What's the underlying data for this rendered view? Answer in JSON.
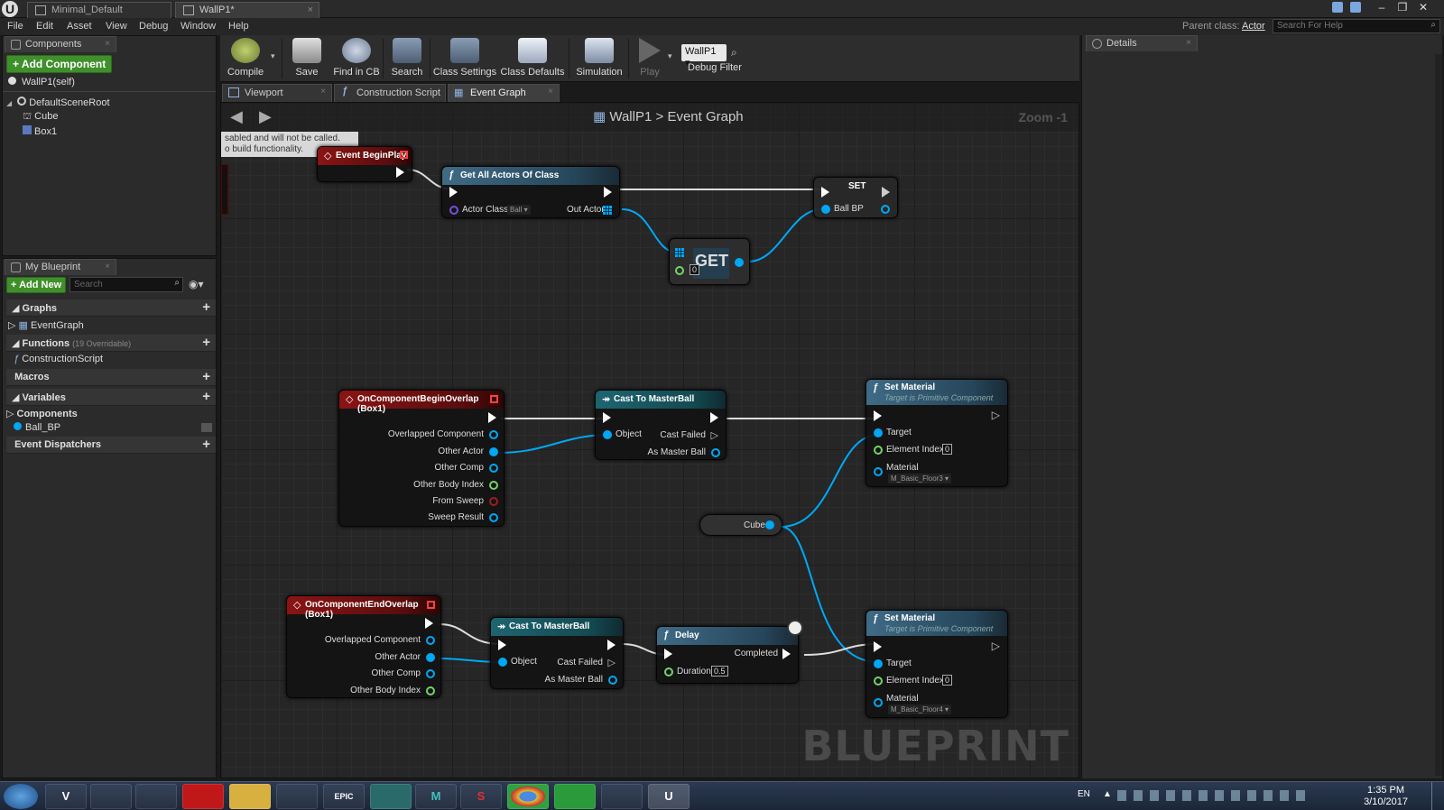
{
  "window": {
    "tabs": [
      {
        "label": "Minimal_Default"
      },
      {
        "label": "WallP1*"
      }
    ]
  },
  "menu": [
    "File",
    "Edit",
    "Asset",
    "View",
    "Debug",
    "Window",
    "Help"
  ],
  "parent_class": {
    "label": "Parent class:",
    "value": "Actor"
  },
  "help_search": {
    "placeholder": "Search For Help"
  },
  "components_panel": {
    "tab": "Components",
    "add_button": "+ Add Component",
    "self_item": "WallP1(self)",
    "root": "DefaultSceneRoot",
    "children": [
      "Cube",
      "Box1"
    ]
  },
  "my_blueprint": {
    "tab": "My Blueprint",
    "add_new": "+ Add New",
    "search_placeholder": "Search",
    "graphs_header": "Graphs",
    "graphs": [
      "EventGraph"
    ],
    "functions_header": "Functions",
    "functions_count": "(19 Overridable)",
    "functions": [
      "ConstructionScript"
    ],
    "macros_header": "Macros",
    "variables_header": "Variables",
    "var_category": "Components",
    "variables": [
      "Ball_BP"
    ],
    "dispatchers_header": "Event Dispatchers"
  },
  "toolbar": {
    "compile": "Compile",
    "save": "Save",
    "find_in_cb": "Find in CB",
    "search": "Search",
    "class_settings": "Class Settings",
    "class_defaults": "Class Defaults",
    "simulation": "Simulation",
    "play": "Play",
    "debug_object": "WallP1",
    "debug_filter": "Debug Filter"
  },
  "graph_tabs": [
    "Viewport",
    "Construction Script",
    "Event Graph"
  ],
  "graph": {
    "breadcrumb_root": "WallP1",
    "breadcrumb_sep": ">",
    "breadcrumb_current": "Event Graph",
    "zoom": "Zoom -1",
    "warning_line1": "sabled and will not be called.",
    "warning_line2": "o build functionality.",
    "watermark": "BLUEPRINT"
  },
  "nodes": {
    "begin_play": {
      "title": "Event BeginPlay"
    },
    "get_all_actors": {
      "title": "Get All Actors Of Class",
      "actor_class": "Actor Class",
      "class_value": "Ball",
      "out_actors": "Out Actors"
    },
    "set": {
      "title": "SET",
      "ball_bp": "Ball BP"
    },
    "get": {
      "title": "GET",
      "index": "0"
    },
    "begin_overlap": {
      "title": "OnComponentBeginOverlap (Box1)",
      "pins": [
        "Overlapped Component",
        "Other Actor",
        "Other Comp",
        "Other Body Index",
        "From Sweep",
        "Sweep Result"
      ]
    },
    "cast1": {
      "title": "Cast To MasterBall",
      "object": "Object",
      "cast_failed": "Cast Failed",
      "as_master": "As Master Ball"
    },
    "set_material1": {
      "title": "Set Material",
      "subtitle": "Target is Primitive Component",
      "target": "Target",
      "element_index": "Element Index",
      "index_val": "0",
      "material": "Material",
      "material_val": "M_Basic_Floor3"
    },
    "cube": {
      "label": "Cube"
    },
    "end_overlap": {
      "title": "OnComponentEndOverlap (Box1)",
      "pins": [
        "Overlapped Component",
        "Other Actor",
        "Other Comp",
        "Other Body Index"
      ]
    },
    "cast2": {
      "title": "Cast To MasterBall",
      "object": "Object",
      "cast_failed": "Cast Failed",
      "as_master": "As Master Ball"
    },
    "delay": {
      "title": "Delay",
      "completed": "Completed",
      "duration": "Duration",
      "duration_val": "0.5"
    },
    "set_material2": {
      "title": "Set Material",
      "subtitle": "Target is Primitive Component",
      "target": "Target",
      "element_index": "Element Index",
      "index_val": "0",
      "material": "Material",
      "material_val": "M_Basic_Floor4"
    }
  },
  "details": {
    "tab": "Details"
  },
  "taskbar": {
    "apps": [
      "V",
      "",
      "",
      "",
      "",
      "",
      "EPIC",
      "",
      "M",
      "S",
      "",
      "",
      "",
      "U"
    ],
    "lang": "EN",
    "time": "1:35 PM",
    "date": "3/10/2017"
  },
  "colors": {
    "exec": "#ffffff",
    "object_pin": "#00a8f4",
    "int_pin": "#76d26b",
    "event_header": "#8b1414",
    "function_header": "#3f6b86"
  }
}
